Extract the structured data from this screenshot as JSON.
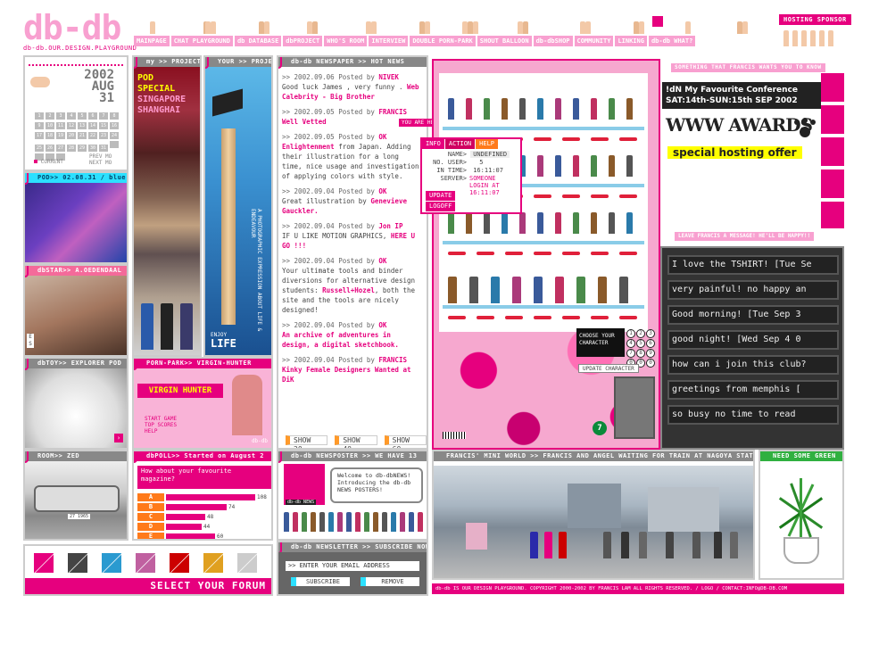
{
  "site": {
    "logo": "db-db",
    "subtitle": "db-db.OUR.DESIGN.PLAYGROUND"
  },
  "nav": [
    "MAINPAGE",
    "CHAT PLAYGROUND",
    "db DATABASE",
    "dbPROJECT",
    "WHO'S ROOM",
    "INTERVIEW",
    "DOUBLE PORN-PARK",
    "SHOUT BALLOON",
    "db-dbSHOP",
    "COMMUNITY",
    "LINKING",
    "db-db WHAT?"
  ],
  "sponsor": "HOSTING SPONSOR",
  "calendar": {
    "year": "2002",
    "month": "AUG",
    "day": "31",
    "current": "CURRENT",
    "prev": "PREV MO",
    "next": "NEXT MO"
  },
  "panels": {
    "project_my": "my >> PROJECT",
    "project_your": "YOUR >> PROJECT",
    "pod": "POD>> 02.08.31 / blue",
    "dbstar": "dbSTAR>> A.OEDENDAAL",
    "dbtoy": "dbTOY>> EXPLORER POD",
    "pornpark": "PORN-PARK>> VIRGIN-HUNTER",
    "room": "ROOM>> ZED",
    "poll": "dbPOLL>> Started on August 2",
    "newsposter": "db-db NEWSPOSTER >> WE HAVE 13",
    "newsletter": "db-db NEWSLETTER >> SUBSCRIBE NOW",
    "newspaper": "db-db NEWSPAPER >> HOT NEWS",
    "miniworld": "FRANCIS' MINI WORLD >> FRANCIS AND ANGEL WAITING FOR TRAIN AT NAGOYA STATION",
    "green": "NEED SOME GREEN",
    "francis_wants": "SOMETHING THAT FRANCIS WANTS YOU TO KNOW",
    "message": "LEAVE FRANCIS A MESSAGE! HE'LL BE HAPPY!!"
  },
  "my_project": {
    "l1": "POD",
    "l2": "SPECIAL",
    "l3": "SINGAPORE",
    "l4": "SHANGHAI"
  },
  "your_project": {
    "vert": "A PHOTOGRAPHIC EXPRESSION ABOUT LIFE & ENDEAVOUR",
    "enjoy": "ENJOY",
    "life": "LIFE"
  },
  "es": [
    "E",
    "S"
  ],
  "news": [
    {
      "head": ">> 2002.09.06 Posted by ",
      "by": "NIVEK",
      "text": "Good luck James , very funny . ",
      "link": "Web Calebrity - Big Brother"
    },
    {
      "head": ">> 2002.09.05 Posted by ",
      "by": "FRANCIS",
      "text": "",
      "link": "Well Vetted"
    },
    {
      "head": ">> 2002.09.05 Posted by ",
      "by": "OK",
      "link": "Enlightenment",
      "text": " from Japan. Adding their illustration for a long time, nice usage and investigation of applying colors with style."
    },
    {
      "head": ">> 2002.09.04 Posted by ",
      "by": "OK",
      "text": "Great illustration by ",
      "link": "Genevieve Gauckler."
    },
    {
      "head": ">> 2002.09.04 Posted by ",
      "by": "Jon IP",
      "text": "IF U LIKE MOTION GRAPHICS, ",
      "link": "HERE U GO !!!"
    },
    {
      "head": ">> 2002.09.04 Posted by ",
      "by": "OK",
      "text": "Your ultimate tools and binder diversions for alternative design students: ",
      "link": "Russell+Hozel",
      "tail": ", both the site and the tools are nicely designed!"
    },
    {
      "head": ">> 2002.09.04 Posted by ",
      "by": "OK",
      "text": "",
      "link": "An archive of adventures in design, a digital sketchbook."
    },
    {
      "head": ">> 2002.09.04 Posted by ",
      "by": "FRANCIS",
      "text": "",
      "link": "Kinky Female Designers Wanted at DiK"
    }
  ],
  "show_buttons": [
    "SHOW 20",
    "SHOW 40",
    "SHOW 60"
  ],
  "here": "YOU ARE HERE!",
  "info": {
    "tabs": [
      "INFO",
      "ACTION",
      "HELP"
    ],
    "name_label": "NAME>",
    "name": "UNDEFINED",
    "user_label": "NO. USER>",
    "users": "5",
    "time_label": "IN TIME>",
    "time": "16:11:07",
    "server_label": "SERVER>",
    "server": "SOMEONE LOGIN AT 16:11:07",
    "update": "UPDATE",
    "logoff": "LOGOFF"
  },
  "lounge": {
    "normal1": "NORMAL",
    "normal2": "NORMAL",
    "special": "SPECIAL",
    "choose": "CHOOSE YOUR CHARACTER",
    "update": "UPDATE CHARACTER",
    "nums": [
      "1",
      "2",
      "3",
      "4",
      "5",
      "6",
      "7",
      "8",
      "9",
      "0",
      "0",
      "0"
    ],
    "seven": "7"
  },
  "virgin": {
    "title": "VIRGIN HUNTER",
    "menu1": "START GAME",
    "menu2": "TOP SCORES",
    "menu3": "HELP",
    "tag": "db-db"
  },
  "poll": {
    "q": "How about your favourite magazine?",
    "opts": [
      {
        "k": "A",
        "v": "108",
        "f": 1.0
      },
      {
        "k": "B",
        "v": "74",
        "f": 0.68
      },
      {
        "k": "C",
        "v": "48",
        "f": 0.44
      },
      {
        "k": "D",
        "v": "44",
        "f": 0.4
      },
      {
        "k": "E",
        "v": "60",
        "f": 0.55
      }
    ]
  },
  "poster": {
    "msg": "Welcome to db-dbNEWS! Introducing the db-db NEWS POSTERS!",
    "tag": "db-db NEWS"
  },
  "newsletter": {
    "label": ">> ENTER YOUR EMAIL ADDRESS",
    "subscribe": "SUBSCRIBE",
    "remove": "REMOVE"
  },
  "forum": "SELECT YOUR FORUM",
  "wants": {
    "title": "!dN My Favourite Conference",
    "date": "SAT:14th-SUN:15th SEP 2002",
    "awards": "WWW AWARDS",
    "hosting": "special hosting offer"
  },
  "messages": [
    "I love the TSHIRT! [Tue Se",
    "very painful! no happy an",
    "Good morning! [Tue Sep 3",
    "good night! [Wed Sep 4 0",
    "how can i join this club?",
    "greetings from memphis [",
    "so busy no time to read"
  ],
  "footer": "db-db IS OUR DESIGN PLAYGROUND. COPYRIGHT 2000-2002 BY FRANCIS LAM ALL RIGHTS RESERVED. / LOGO / CONTACT:INFO@DB-DB.COM",
  "plate": "27 1965",
  "colors": {
    "accent": "#e6007e",
    "light": "#f8a0d0",
    "cyan": "#2ce0ff",
    "green": "#30b040"
  }
}
